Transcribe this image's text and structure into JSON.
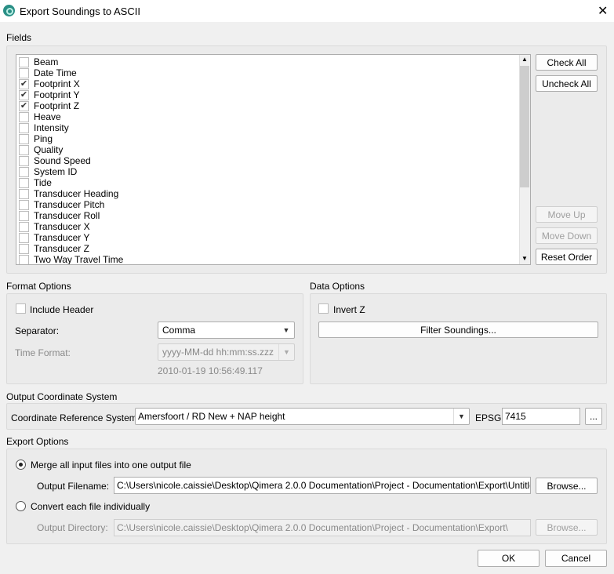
{
  "window": {
    "title": "Export Soundings to ASCII",
    "close": "✕"
  },
  "fields": {
    "label": "Fields",
    "items": [
      {
        "label": "Beam",
        "checked": false
      },
      {
        "label": "Date Time",
        "checked": false
      },
      {
        "label": "Footprint X",
        "checked": true
      },
      {
        "label": "Footprint Y",
        "checked": true
      },
      {
        "label": "Footprint Z",
        "checked": true
      },
      {
        "label": "Heave",
        "checked": false
      },
      {
        "label": "Intensity",
        "checked": false
      },
      {
        "label": "Ping",
        "checked": false
      },
      {
        "label": "Quality",
        "checked": false
      },
      {
        "label": "Sound Speed",
        "checked": false
      },
      {
        "label": "System ID",
        "checked": false
      },
      {
        "label": "Tide",
        "checked": false
      },
      {
        "label": "Transducer Heading",
        "checked": false
      },
      {
        "label": "Transducer Pitch",
        "checked": false
      },
      {
        "label": "Transducer Roll",
        "checked": false
      },
      {
        "label": "Transducer X",
        "checked": false
      },
      {
        "label": "Transducer Y",
        "checked": false
      },
      {
        "label": "Transducer Z",
        "checked": false
      },
      {
        "label": "Two Way Travel Time",
        "checked": false
      }
    ],
    "check_all": "Check All",
    "uncheck_all": "Uncheck All",
    "move_up": "Move Up",
    "move_down": "Move Down",
    "reset_order": "Reset Order"
  },
  "format": {
    "label": "Format Options",
    "include_header": "Include Header",
    "separator_label": "Separator:",
    "separator_value": "Comma",
    "time_format_label": "Time Format:",
    "time_format_value": "yyyy-MM-dd hh:mm:ss.zzz",
    "time_preview": "2010-01-19 10:56:49.117"
  },
  "data_options": {
    "label": "Data Options",
    "invert_z": "Invert Z",
    "filter": "Filter Soundings..."
  },
  "coord": {
    "label": "Output Coordinate System",
    "crs_label": "Coordinate Reference System:",
    "crs_value": "Amersfoort / RD New + NAP height",
    "epsg_label": "EPSG:",
    "epsg_value": "7415",
    "more": "..."
  },
  "export": {
    "label": "Export Options",
    "merge": "Merge all input files into one output file",
    "filename_label": "Output Filename:",
    "filename_value": "C:\\Users\\nicole.caissie\\Desktop\\Qimera 2.0.0 Documentation\\Project - Documentation\\Export\\Untitled",
    "browse": "Browse...",
    "individual": "Convert each file individually",
    "dir_label": "Output Directory:",
    "dir_value": "C:\\Users\\nicole.caissie\\Desktop\\Qimera 2.0.0 Documentation\\Project - Documentation\\Export\\",
    "browse2": "Browse..."
  },
  "footer": {
    "ok": "OK",
    "cancel": "Cancel"
  }
}
